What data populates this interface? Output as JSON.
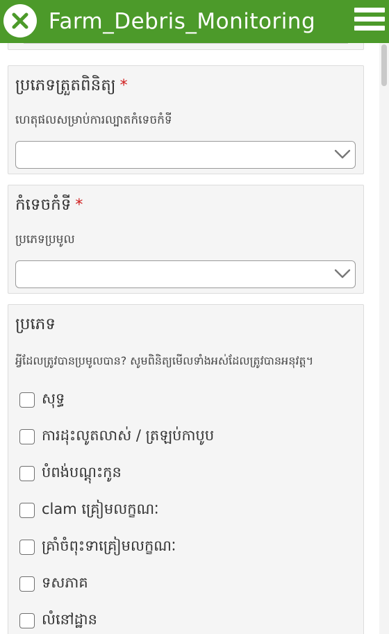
{
  "header": {
    "title": "Farm_Debris_Monitoring",
    "close_icon": "close-icon",
    "menu_icon": "hamburger-menu-icon",
    "bar_color": "#4c9a2a"
  },
  "survey_type": {
    "label": "ប្រភេទត្រួតពិនិត្យ",
    "required_mark": "*",
    "hint": "ហេតុផលសម្រាប់ការល្បាតកំទេចកំទី",
    "selected_value": ""
  },
  "debris": {
    "label": "កំទេចកំទី",
    "required_mark": "*",
    "hint": "ប្រភេទប្រមូល",
    "selected_value": ""
  },
  "types": {
    "label": "ប្រភេទ",
    "hint": "អ្វីដែលត្រូវបានប្រមូលបាន? សូមពិនិត្យមើលទាំងអស់ដែលត្រូវបានអនុវត្ត។",
    "options": [
      {
        "label": "សុទ្ធ",
        "checked": false
      },
      {
        "label": "ការដុះលូតលាស់ / ត្រឡប់កាបូប",
        "checked": false
      },
      {
        "label": "បំពង់បណ្តុះកូន",
        "checked": false
      },
      {
        "label": "clam គ្រៀមលក្ខណៈ",
        "checked": false
      },
      {
        "label": "គ្រាំចំពុះទាគ្រៀមលក្ខណៈ",
        "checked": false
      },
      {
        "label": "ទសភាគ",
        "checked": false
      },
      {
        "label": "លំនៅដ្ឋាន",
        "checked": false
      }
    ]
  }
}
